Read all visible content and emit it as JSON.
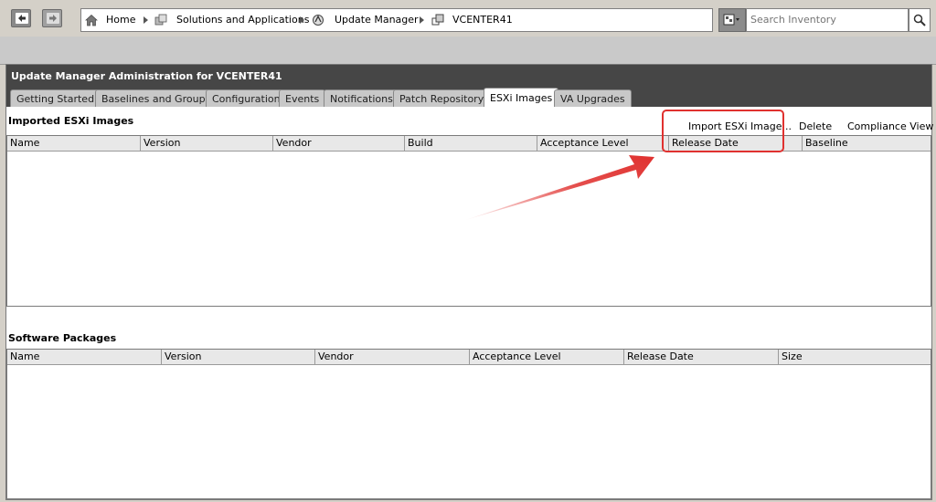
{
  "nav": {
    "breadcrumb": [
      "Home",
      "Solutions and Applications",
      "Update Manager",
      "VCENTER41"
    ],
    "search_placeholder": "Search Inventory"
  },
  "panel": {
    "title": "Update Manager Administration for VCENTER41",
    "tabs": [
      {
        "label": "Getting Started"
      },
      {
        "label": "Baselines and Groups"
      },
      {
        "label": "Configuration"
      },
      {
        "label": "Events"
      },
      {
        "label": "Notifications"
      },
      {
        "label": "Patch Repository"
      },
      {
        "label": "ESXi Images",
        "active": true
      },
      {
        "label": "VA Upgrades"
      }
    ]
  },
  "imported": {
    "title": "Imported ESXi Images",
    "actions": {
      "import": "Import ESXi Image...",
      "delete": "Delete",
      "compliance": "Compliance View"
    },
    "columns": [
      "Name",
      "Version",
      "Vendor",
      "Build",
      "Acceptance Level",
      "Release Date",
      "Baseline"
    ]
  },
  "packages": {
    "title": "Software Packages",
    "columns": [
      "Name",
      "Version",
      "Vendor",
      "Acceptance Level",
      "Release Date",
      "Size"
    ]
  },
  "colors": {
    "accent": "#e0312f",
    "titlebar": "#464646"
  }
}
